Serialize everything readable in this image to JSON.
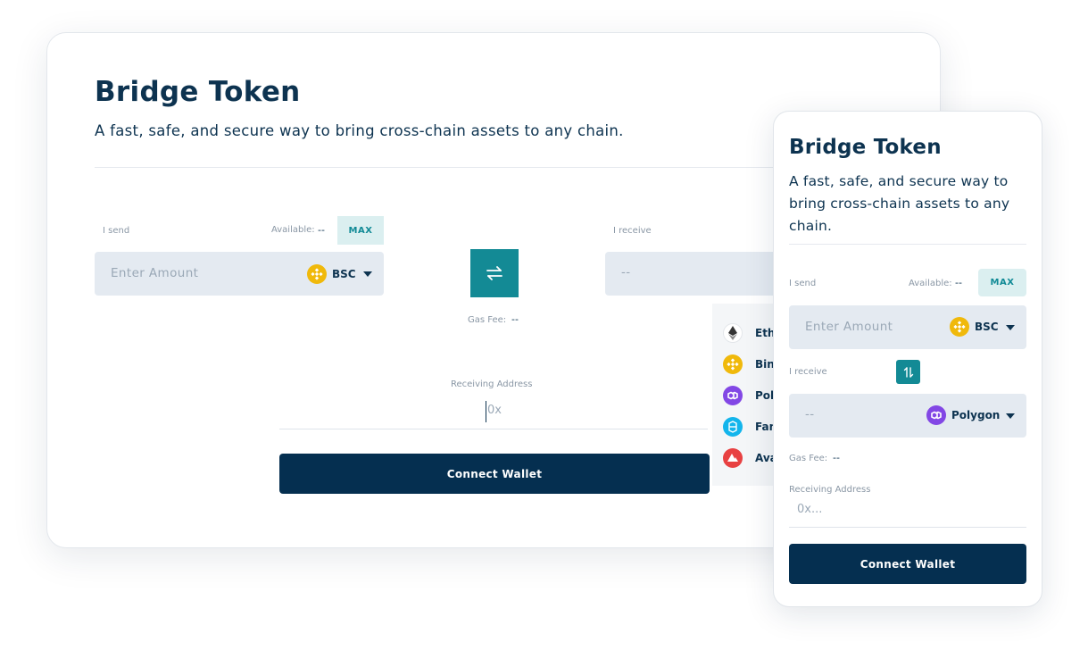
{
  "desktop": {
    "title": "Bridge Token",
    "subtitle": "A fast, safe, and secure way to bring cross-chain assets to any chain.",
    "send_label": "I send",
    "available_label": "Available:",
    "available_value": "--",
    "max_label": "MAX",
    "amount_placeholder": "Enter Amount",
    "send_chain": "BSC",
    "receive_label": "I receive",
    "receive_value": "--",
    "gas_fee_label": "Gas Fee:",
    "gas_fee_value": "--",
    "address_label": "Receiving Address",
    "address_placeholder": "0x",
    "connect_label": "Connect Wallet",
    "chain_menu": [
      {
        "label": "Ethe",
        "icon": "ethereum-icon"
      },
      {
        "label": "Bina",
        "icon": "binance-icon"
      },
      {
        "label": "Poly",
        "icon": "polygon-icon"
      },
      {
        "label": "Fan",
        "icon": "fantom-icon"
      },
      {
        "label": "Ava",
        "icon": "avalanche-icon"
      }
    ]
  },
  "mobile": {
    "title": "Bridge Token",
    "subtitle": "A fast, safe, and secure way to bring cross-chain assets to any chain.",
    "send_label": "I send",
    "available_label": "Available:",
    "available_value": "--",
    "max_label": "MAX",
    "amount_placeholder": "Enter Amount",
    "send_chain": "BSC",
    "receive_label": "I receive",
    "receive_value": "--",
    "receive_chain": "Polygon",
    "gas_fee_label": "Gas Fee:",
    "gas_fee_value": "--",
    "address_label": "Receiving Address",
    "address_placeholder": "0x...",
    "connect_label": "Connect Wallet"
  },
  "colors": {
    "brand_navy": "#052f50",
    "accent_teal": "#138a95",
    "field_bg": "#e4eaf1",
    "max_bg": "#dbeff0",
    "bsc": "#f0b90b",
    "polygon": "#8247e5",
    "fantom": "#13b5ec",
    "avalanche": "#e84142"
  }
}
